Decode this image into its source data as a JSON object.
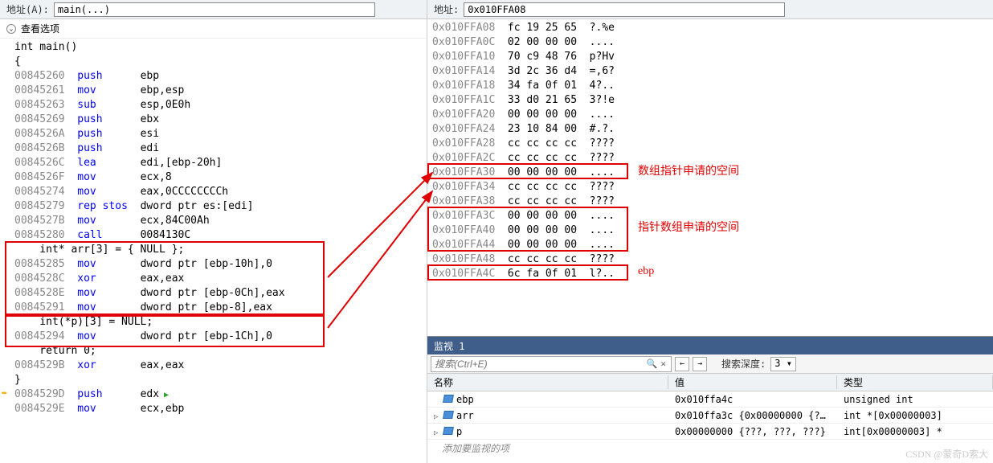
{
  "left": {
    "addr_label": "地址(A):",
    "addr_value": "main(...)",
    "collapse_label": "查看选项",
    "lines": [
      {
        "t": "src",
        "text": "int main()"
      },
      {
        "t": "src",
        "text": "{"
      },
      {
        "t": "asm",
        "addr": "00845260",
        "mn": "push",
        "op": "ebp"
      },
      {
        "t": "asm",
        "addr": "00845261",
        "mn": "mov",
        "op": "ebp,esp"
      },
      {
        "t": "asm",
        "addr": "00845263",
        "mn": "sub",
        "op": "esp,0E0h"
      },
      {
        "t": "asm",
        "addr": "00845269",
        "mn": "push",
        "op": "ebx"
      },
      {
        "t": "asm",
        "addr": "0084526A",
        "mn": "push",
        "op": "esi"
      },
      {
        "t": "asm",
        "addr": "0084526B",
        "mn": "push",
        "op": "edi"
      },
      {
        "t": "asm",
        "addr": "0084526C",
        "mn": "lea",
        "op": "edi,[ebp-20h]"
      },
      {
        "t": "asm",
        "addr": "0084526F",
        "mn": "mov",
        "op": "ecx,8"
      },
      {
        "t": "asm",
        "addr": "00845274",
        "mn": "mov",
        "op": "eax,0CCCCCCCCh"
      },
      {
        "t": "asm",
        "addr": "00845279",
        "mn": "rep stos",
        "op": "dword ptr es:[edi]"
      },
      {
        "t": "asm",
        "addr": "0084527B",
        "mn": "mov",
        "op": "ecx,84C00Ah"
      },
      {
        "t": "asm",
        "addr": "00845280",
        "mn": "call",
        "op": "0084130C"
      },
      {
        "t": "src",
        "text": "    int* arr[3] = { NULL };"
      },
      {
        "t": "asm",
        "addr": "00845285",
        "mn": "mov",
        "op": "dword ptr [ebp-10h],0"
      },
      {
        "t": "asm",
        "addr": "0084528C",
        "mn": "xor",
        "op": "eax,eax"
      },
      {
        "t": "asm",
        "addr": "0084528E",
        "mn": "mov",
        "op": "dword ptr [ebp-0Ch],eax"
      },
      {
        "t": "asm",
        "addr": "00845291",
        "mn": "mov",
        "op": "dword ptr [ebp-8],eax"
      },
      {
        "t": "src",
        "text": "    int(*p)[3] = NULL;"
      },
      {
        "t": "asm",
        "addr": "00845294",
        "mn": "mov",
        "op": "dword ptr [ebp-1Ch],0"
      },
      {
        "t": "src",
        "text": "    return 0;"
      },
      {
        "t": "asm",
        "addr": "0084529B",
        "mn": "xor",
        "op": "eax,eax",
        "cur": true
      },
      {
        "t": "src",
        "text": "}"
      },
      {
        "t": "asm",
        "addr": "0084529D",
        "mn": "push",
        "op": "edx",
        "play": true
      },
      {
        "t": "asm",
        "addr": "0084529E",
        "mn": "mov",
        "op": "ecx,ebp"
      }
    ]
  },
  "right": {
    "addr_label": "地址:",
    "addr_value": "0x010FFA08",
    "memory": [
      {
        "addr": "0x010FFA08",
        "hex": "fc 19 25 65",
        "asc": "?.%e"
      },
      {
        "addr": "0x010FFA0C",
        "hex": "02 00 00 00",
        "asc": "...."
      },
      {
        "addr": "0x010FFA10",
        "hex": "70 c9 48 76",
        "asc": "p?Hv"
      },
      {
        "addr": "0x010FFA14",
        "hex": "3d 2c 36 d4",
        "asc": "=,6?"
      },
      {
        "addr": "0x010FFA18",
        "hex": "34 fa 0f 01",
        "asc": "4?.."
      },
      {
        "addr": "0x010FFA1C",
        "hex": "33 d0 21 65",
        "asc": "3?!e"
      },
      {
        "addr": "0x010FFA20",
        "hex": "00 00 00 00",
        "asc": "...."
      },
      {
        "addr": "0x010FFA24",
        "hex": "23 10 84 00",
        "asc": "#.?."
      },
      {
        "addr": "0x010FFA28",
        "hex": "cc cc cc cc",
        "asc": "????"
      },
      {
        "addr": "0x010FFA2C",
        "hex": "cc cc cc cc",
        "asc": "????"
      },
      {
        "addr": "0x010FFA30",
        "hex": "00 00 00 00",
        "asc": "...."
      },
      {
        "addr": "0x010FFA34",
        "hex": "cc cc cc cc",
        "asc": "????"
      },
      {
        "addr": "0x010FFA38",
        "hex": "cc cc cc cc",
        "asc": "????"
      },
      {
        "addr": "0x010FFA3C",
        "hex": "00 00 00 00",
        "asc": "...."
      },
      {
        "addr": "0x010FFA40",
        "hex": "00 00 00 00",
        "asc": "...."
      },
      {
        "addr": "0x010FFA44",
        "hex": "00 00 00 00",
        "asc": "...."
      },
      {
        "addr": "0x010FFA48",
        "hex": "cc cc cc cc",
        "asc": "????"
      },
      {
        "addr": "0x010FFA4C",
        "hex": "6c fa 0f 01",
        "asc": "l?.."
      }
    ],
    "annot1": "数组指针申请的空间",
    "annot2": "指针数组申请的空间",
    "annot3": "ebp"
  },
  "watch": {
    "title": "监视 1",
    "search_placeholder": "搜索(Ctrl+E)",
    "depth_label": "搜索深度:",
    "depth_value": "3",
    "headers": {
      "name": "名称",
      "value": "值",
      "type": "类型"
    },
    "rows": [
      {
        "name": "ebp",
        "value": "0x010ffa4c",
        "type": "unsigned int",
        "expand": false
      },
      {
        "name": "arr",
        "value": "0x010ffa3c {0x00000000 {?...",
        "type": "int *[0x00000003]",
        "expand": true
      },
      {
        "name": "p",
        "value": "0x00000000 {???, ???, ???}",
        "type": "int[0x00000003] *",
        "expand": true
      }
    ],
    "add_label": "添加要监视的项"
  },
  "watermark": "CSDN @蒙奇D索大"
}
